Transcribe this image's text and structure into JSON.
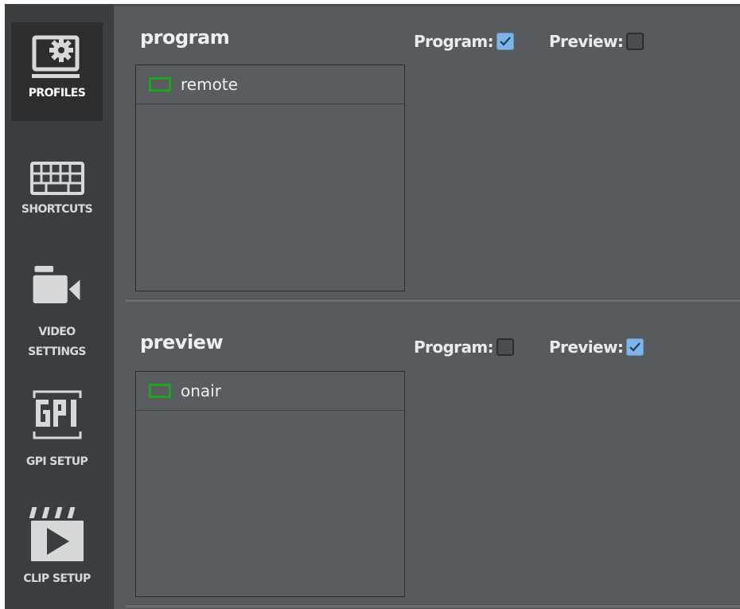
{
  "colors": {
    "sidebar_bg": "#3b3e40",
    "sidebar_active_bg": "#2b2d2f",
    "main_bg": "#585b5e",
    "checkbox_checked": "#7fb5e6",
    "monitor_icon": "#1ea51e"
  },
  "sidebar": {
    "items": [
      {
        "label": "PROFILES",
        "icon": "monitor-gear-icon",
        "active": true
      },
      {
        "label": "SHORTCUTS",
        "icon": "keyboard-icon",
        "active": false
      },
      {
        "label_line1": "VIDEO",
        "label_line2": "SETTINGS",
        "icon": "video-camera-icon",
        "active": false
      },
      {
        "label": "GPI SETUP",
        "icon": "gpi-icon",
        "active": false
      },
      {
        "label": "CLIP SETUP",
        "icon": "clapperboard-play-icon",
        "active": false
      }
    ]
  },
  "sections": [
    {
      "title": "program",
      "program_label": "Program:",
      "program_checked": true,
      "preview_label": "Preview:",
      "preview_checked": false,
      "items": [
        {
          "label": "remote",
          "icon": "monitor-icon"
        }
      ]
    },
    {
      "title": "preview",
      "program_label": "Program:",
      "program_checked": false,
      "preview_label": "Preview:",
      "preview_checked": true,
      "items": [
        {
          "label": "onair",
          "icon": "monitor-icon"
        }
      ]
    }
  ]
}
